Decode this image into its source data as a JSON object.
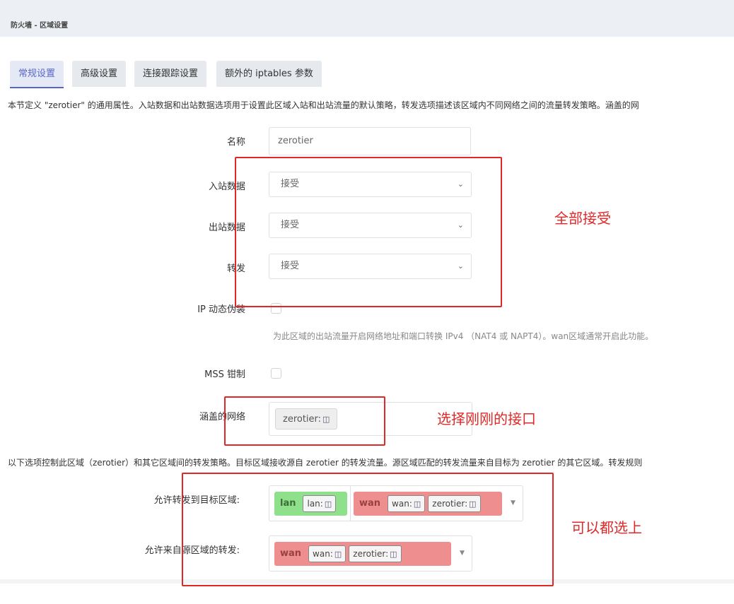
{
  "header": {
    "title": "防火墙 - 区域设置"
  },
  "tabs": [
    {
      "label": "常规设置",
      "active": true
    },
    {
      "label": "高级设置"
    },
    {
      "label": "连接跟踪设置"
    },
    {
      "label": "额外的 iptables 参数"
    }
  ],
  "description": "本节定义 \"zerotier\" 的通用属性。入站数据和出站数据选项用于设置此区域入站和出站流量的默认策略，转发选项描述该区域内不同网络之间的流量转发策略。涵盖的网",
  "form": {
    "name": {
      "label": "名称",
      "value": "zerotier"
    },
    "input": {
      "label": "入站数据",
      "value": "接受"
    },
    "output": {
      "label": "出站数据",
      "value": "接受"
    },
    "forward": {
      "label": "转发",
      "value": "接受"
    },
    "masq": {
      "label": "IP 动态伪装",
      "hint": "为此区域的出站流量开启网络地址和端口转换 IPv4 （NAT4 或 NAPT4）。wan区域通常开启此功能。"
    },
    "mss": {
      "label": "MSS 钳制"
    },
    "covered": {
      "label": "涵盖的网络",
      "chip": "zerotier:"
    }
  },
  "forwarding_desc": "以下选项控制此区域（zerotier）和其它区域间的转发策略。目标区域接收源自 zerotier 的转发流量。源区域匹配的转发流量来自目标为 zerotier 的其它区域。转发规则",
  "forward_dest": {
    "label": "允许转发到目标区域:",
    "zones": [
      {
        "name": "lan",
        "color": "#8fe08a",
        "chips": [
          "lan:"
        ]
      },
      {
        "name": "wan",
        "color": "#ee8e8e",
        "chips": [
          "wan:",
          "zerotier:"
        ]
      }
    ]
  },
  "forward_src": {
    "label": "允许来自源区域的转发:",
    "zones": [
      {
        "name": "wan",
        "color": "#ee8e8e",
        "chips": [
          "wan:",
          "zerotier:"
        ]
      }
    ]
  },
  "annotations": {
    "accept_all": "全部接受",
    "select_interface": "选择刚刚的接口",
    "select_all": "可以都选上"
  },
  "colors": {
    "accent": "#5866c8",
    "annotation": "#e02828"
  }
}
